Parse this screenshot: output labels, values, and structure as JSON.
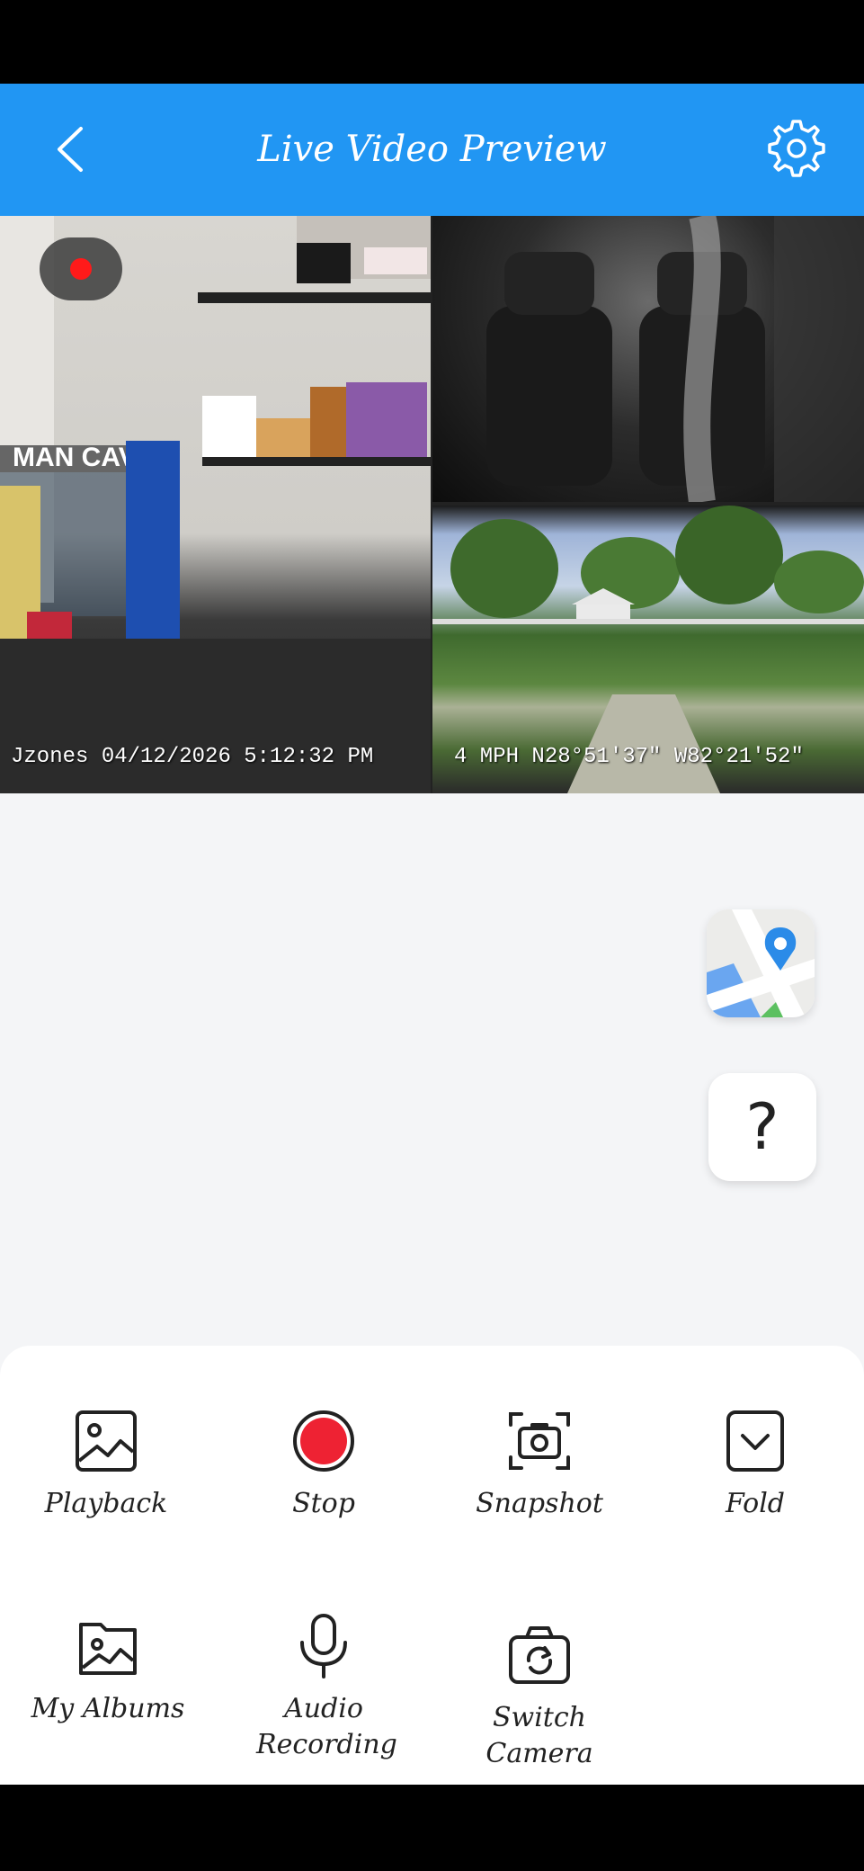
{
  "header": {
    "title": "Live Video Preview"
  },
  "video": {
    "overlay_left": "Jzones 04/12/2026 5:12:32 PM",
    "overlay_right": "4 MPH N28°51'37\" W82°21'52\"",
    "garage_sign": "MAN CAVE"
  },
  "help": {
    "label": "?"
  },
  "actions": [
    {
      "label": "Playback",
      "icon": "image-icon"
    },
    {
      "label": "Stop",
      "icon": "record-stop-icon"
    },
    {
      "label": "Snapshot",
      "icon": "camera-icon"
    },
    {
      "label": "Fold",
      "icon": "chevron-down-icon"
    },
    {
      "label": "My Albums",
      "icon": "album-icon"
    },
    {
      "label": "Audio Recording",
      "icon": "microphone-icon"
    },
    {
      "label": "Switch Camera",
      "icon": "switch-camera-icon"
    }
  ],
  "colors": {
    "header": "#2196f3",
    "record": "#ff1a1a",
    "stop": "#ee2233"
  }
}
